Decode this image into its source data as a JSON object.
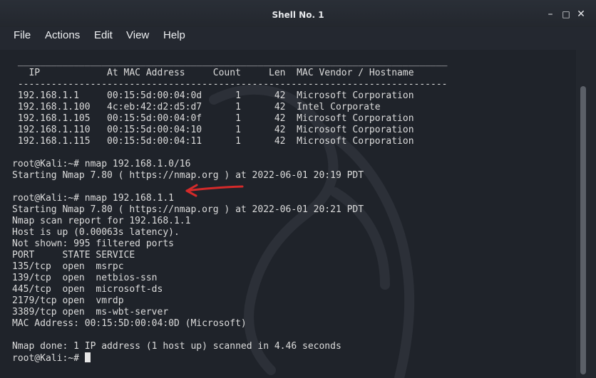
{
  "window": {
    "title": "Shell No. 1",
    "controls": [
      "minimize",
      "maximize",
      "close"
    ]
  },
  "menu": [
    "File",
    "Actions",
    "Edit",
    "View",
    "Help"
  ],
  "terminal": {
    "lines": [
      " _____________________________________________________________________________",
      "   IP            At MAC Address     Count     Len  MAC Vendor / Hostname",
      " -----------------------------------------------------------------------------",
      " 192.168.1.1     00:15:5d:00:04:0d      1      42  Microsoft Corporation",
      " 192.168.1.100   4c:eb:42:d2:d5:d7      1      42  Intel Corporate",
      " 192.168.1.105   00:15:5d:00:04:0f      1      42  Microsoft Corporation",
      " 192.168.1.110   00:15:5d:00:04:10      1      42  Microsoft Corporation",
      " 192.168.1.115   00:15:5d:00:04:11      1      42  Microsoft Corporation",
      "",
      "root@Kali:~# nmap 192.168.1.0/16",
      "Starting Nmap 7.80 ( https://nmap.org ) at 2022-06-01 20:19 PDT",
      "",
      "root@Kali:~# nmap 192.168.1.1",
      "Starting Nmap 7.80 ( https://nmap.org ) at 2022-06-01 20:21 PDT",
      "Nmap scan report for 192.168.1.1",
      "Host is up (0.00063s latency).",
      "Not shown: 995 filtered ports",
      "PORT     STATE SERVICE",
      "135/tcp  open  msrpc",
      "139/tcp  open  netbios-ssn",
      "445/tcp  open  microsoft-ds",
      "2179/tcp open  vmrdp",
      "3389/tcp open  ms-wbt-server",
      "MAC Address: 00:15:5D:00:04:0D (Microsoft)",
      "",
      "Nmap done: 1 IP address (1 host up) scanned in 4.46 seconds",
      "root@Kali:~# "
    ]
  },
  "colors": {
    "terminal_bg": "#1f232a",
    "text": "#dcdcdc",
    "annotation_arrow": "#d42a2a"
  },
  "icons": [
    "minimize-icon",
    "maximize-icon",
    "close-icon",
    "kali-dragon-watermark",
    "annotation-arrow"
  ]
}
